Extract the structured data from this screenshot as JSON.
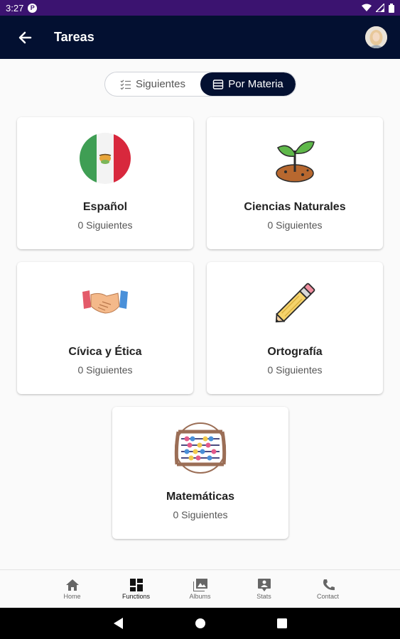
{
  "status_bar": {
    "time": "3:27",
    "notification_icon": "P"
  },
  "app_bar": {
    "title": "Tareas"
  },
  "toggle": {
    "options": [
      {
        "label": "Siguientes",
        "icon": "checklist-icon",
        "selected": false
      },
      {
        "label": "Por Materia",
        "icon": "subject-icon",
        "selected": true
      }
    ]
  },
  "subjects": [
    {
      "name": "Español",
      "count": "0 Siguientes",
      "icon": "mexico-flag-icon"
    },
    {
      "name": "Ciencias Naturales",
      "count": "0 Siguientes",
      "icon": "plant-sprout-icon"
    },
    {
      "name": "Cívica y Ética",
      "count": "0 Siguientes",
      "icon": "handshake-icon"
    },
    {
      "name": "Ortografía",
      "count": "0 Siguientes",
      "icon": "pencil-icon"
    },
    {
      "name": "Matemáticas",
      "count": "0 Siguientes",
      "icon": "abacus-icon"
    }
  ],
  "bottom_nav": {
    "items": [
      {
        "label": "Home",
        "icon": "home-icon",
        "active": false
      },
      {
        "label": "Functions",
        "icon": "dashboard-icon",
        "active": true
      },
      {
        "label": "Albums",
        "icon": "photo-album-icon",
        "active": false
      },
      {
        "label": "Stats",
        "icon": "stats-icon",
        "active": false
      },
      {
        "label": "Contact",
        "icon": "phone-icon",
        "active": false
      }
    ]
  },
  "colors": {
    "status_bar": "#3b1370",
    "app_bar": "#031031",
    "accent": "#031031"
  }
}
